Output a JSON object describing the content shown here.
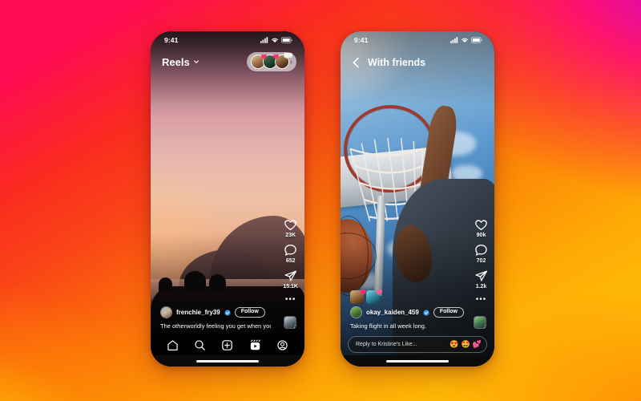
{
  "background": {
    "gradient_colors": [
      "#cc00d8",
      "#ff0a54",
      "#fa4616",
      "#fd8c06",
      "#ffc107"
    ]
  },
  "phones": [
    {
      "id": "left",
      "status_bar": {
        "time": "9:41",
        "signal_icon": "cellular-signal-icon",
        "wifi_icon": "wifi-icon",
        "battery_icon": "battery-icon"
      },
      "top_bar": {
        "title": "Reels",
        "chevron_icon": "chevron-down-icon",
        "story_pill": {
          "chevron_icon": "chevron-right-icon",
          "avatars": [
            {
              "name": "story-avatar-1",
              "sticker": "heart-sticker"
            },
            {
              "name": "story-avatar-2",
              "sticker": "heart-sticker"
            },
            {
              "name": "story-avatar-3",
              "sticker": "speech-bubble-sticker"
            }
          ]
        }
      },
      "video": {
        "description": "sunset-landscape"
      },
      "rail": [
        {
          "icon": "heart-icon",
          "count": "23K"
        },
        {
          "icon": "comment-icon",
          "count": "652"
        },
        {
          "icon": "share-icon",
          "count": "15.1K"
        },
        {
          "icon": "more-options-icon",
          "count": ""
        }
      ],
      "caption": {
        "username": "frenchie_fry39",
        "verified_icon": "verified-badge-icon",
        "follow_label": "Follow",
        "text": "The otherworldly feeling you get when you d...",
        "audio_icon": "music-note-icon"
      },
      "bottom_nav": [
        {
          "name": "nav-home",
          "icon": "home-icon"
        },
        {
          "name": "nav-search",
          "icon": "search-icon"
        },
        {
          "name": "nav-create",
          "icon": "plus-square-icon"
        },
        {
          "name": "nav-reels",
          "icon": "reels-icon"
        },
        {
          "name": "nav-profile",
          "icon": "profile-icon"
        }
      ]
    },
    {
      "id": "right",
      "status_bar": {
        "time": "9:41",
        "signal_icon": "cellular-signal-icon",
        "wifi_icon": "wifi-icon",
        "battery_icon": "battery-icon"
      },
      "top_bar": {
        "title": "With friends",
        "back_icon": "back-chevron-icon"
      },
      "video": {
        "description": "basketball-dunk"
      },
      "reaction_avatars": [
        {
          "name": "reaction-avatar-1",
          "sticker": "heart-sticker"
        },
        {
          "name": "reaction-avatar-2",
          "sticker": "heart-sticker"
        }
      ],
      "rail": [
        {
          "icon": "heart-icon",
          "count": "90k"
        },
        {
          "icon": "comment-icon",
          "count": "702"
        },
        {
          "icon": "share-icon",
          "count": "1.2k"
        },
        {
          "icon": "more-options-icon",
          "count": ""
        }
      ],
      "caption": {
        "username": "okay_kaiden_459",
        "verified_icon": "verified-badge-icon",
        "follow_label": "Follow",
        "text": "Taking flight in all week long.",
        "audio_icon": "music-note-icon"
      },
      "reply_bar": {
        "placeholder": "Reply to Kristine's Like...",
        "emojis": [
          "😍",
          "🤩",
          "💕"
        ]
      }
    }
  ]
}
